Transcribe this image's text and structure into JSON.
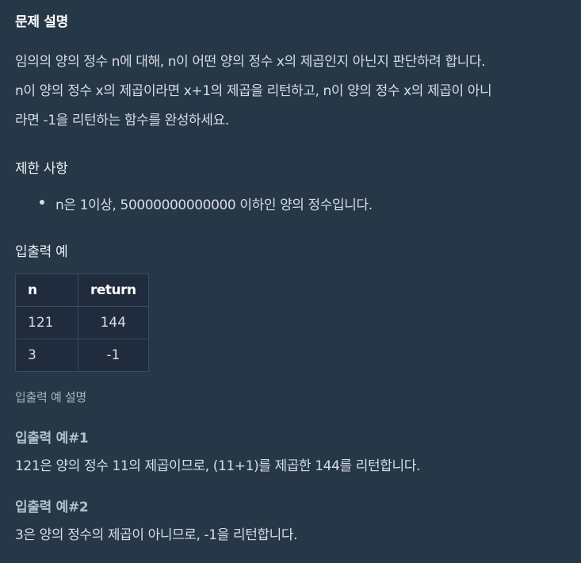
{
  "title": "문제 설명",
  "description": [
    "임의의 양의 정수 n에 대해, n이 어떤 양의 정수 x의 제곱인지 아닌지 판단하려 합니다.",
    "n이 양의 정수 x의 제곱이라면 x+1의 제곱을 리턴하고, n이 양의 정수 x의 제곱이 아니",
    "라면 -1을 리턴하는 함수를 완성하세요."
  ],
  "constraints": {
    "heading": "제한 사항",
    "items": [
      "n은 1이상, 50000000000000 이하인 양의 정수입니다."
    ]
  },
  "io_examples": {
    "heading": "입출력 예",
    "columns": [
      "n",
      "return"
    ],
    "rows": [
      [
        "121",
        "144"
      ],
      [
        "3",
        "-1"
      ]
    ],
    "description_heading": "입출력 예 설명"
  },
  "examples": [
    {
      "heading": "입출력 예#1",
      "text": "121은 양의 정수 11의 제곱이므로, (11+1)를 제곱한 144를 리턴합니다."
    },
    {
      "heading": "입출력 예#2",
      "text": "3은 양의 정수의 제곱이 아니므로, -1을 리턴합니다."
    }
  ],
  "colors": {
    "background": "#263747",
    "table_background": "#202b3d",
    "text": "#d7dde4",
    "heading": "#ffffff"
  }
}
